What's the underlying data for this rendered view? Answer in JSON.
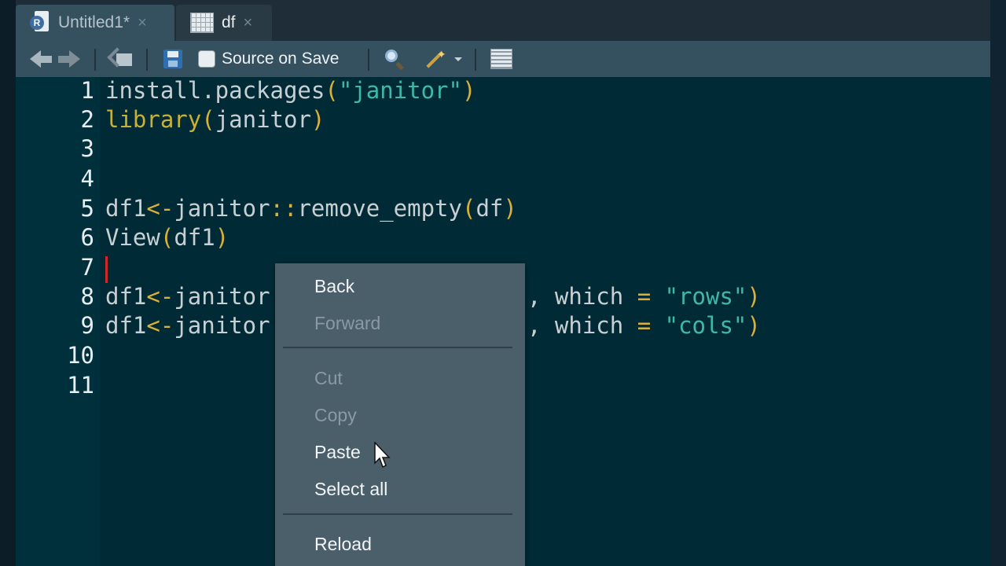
{
  "tabs": [
    {
      "label": "Untitled1*",
      "icon": "r-script-icon",
      "active": true
    },
    {
      "label": "df",
      "icon": "table-grid-icon",
      "active": false
    }
  ],
  "tab_close_glyph": "×",
  "toolbar": {
    "source_on_save_label": "Source on Save",
    "source_on_save_checked": false
  },
  "editor": {
    "line_numbers": [
      "1",
      "2",
      "3",
      "4",
      "5",
      "6",
      "7",
      "8",
      "9",
      "10",
      "11"
    ],
    "lines": {
      "l1": {
        "fn": "install.packages",
        "open": "(",
        "str": "\"janitor\"",
        "close": ")"
      },
      "l2": {
        "fn": "library",
        "open": "(",
        "arg": "janitor",
        "close": ")"
      },
      "l5": {
        "var": "df1",
        "assign": "<-",
        "pkg": "janitor",
        "ns": "::",
        "fn": "remove_empty",
        "open": "(",
        "arg": "df",
        "close": ")"
      },
      "l6": {
        "fn": "View",
        "open": "(",
        "arg": "df1",
        "close": ")"
      },
      "l8": {
        "var": "df1",
        "assign": "<-",
        "pkg": "janitor",
        "comma": ", ",
        "kw": "which",
        "eq": " = ",
        "str": "\"rows\"",
        "close": ")"
      },
      "l9": {
        "var": "df1",
        "assign": "<-",
        "pkg": "janitor",
        "comma": ", ",
        "kw": "which",
        "eq": " = ",
        "str": "\"cols\"",
        "close": ")"
      }
    }
  },
  "context_menu": {
    "back": "Back",
    "forward": "Forward",
    "cut": "Cut",
    "copy": "Copy",
    "paste": "Paste",
    "select_all": "Select all",
    "reload": "Reload"
  },
  "colors": {
    "editor_bg": "#002b36",
    "string": "#3fb8a7",
    "paren": "#d8b03a",
    "cursor": "#d02828"
  }
}
